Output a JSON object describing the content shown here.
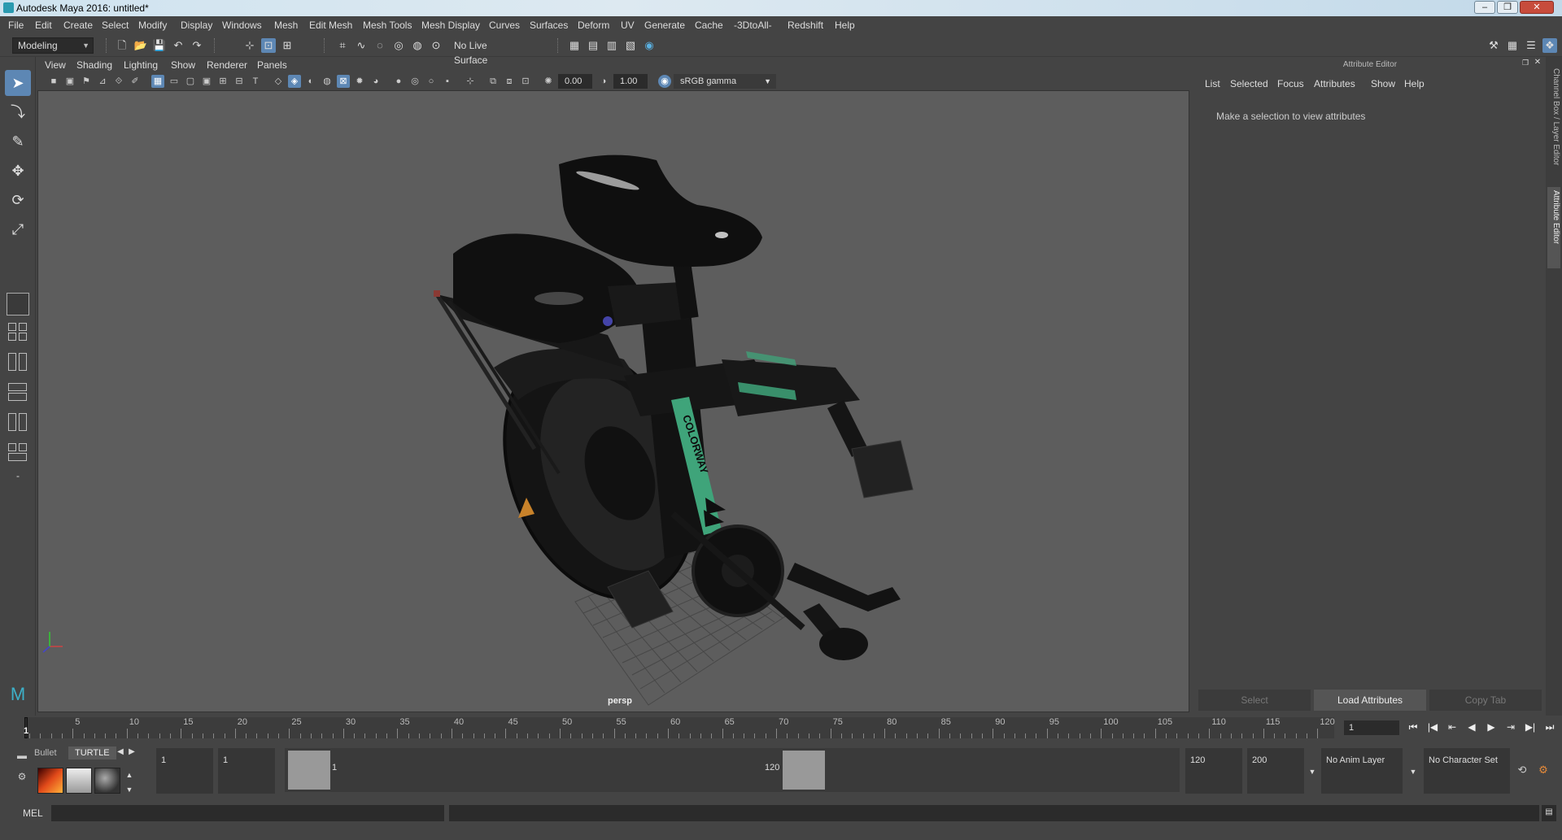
{
  "window": {
    "title": "Autodesk Maya 2016: untitled*",
    "buttons": [
      "–",
      "❐",
      "✕"
    ]
  },
  "menubar": [
    "File",
    "Edit",
    "Create",
    "Select",
    "Modify",
    "Display",
    "Windows",
    "Mesh",
    "Edit Mesh",
    "Mesh Tools",
    "Mesh Display",
    "Curves",
    "Surfaces",
    "Deform",
    "UV",
    "Generate",
    "Cache",
    "-3DtoAll-",
    "Redshift",
    "Help"
  ],
  "toolbar": {
    "mode": "Modeling",
    "live_surface": "No Live Surface"
  },
  "viewport": {
    "menu": [
      "View",
      "Shading",
      "Lighting",
      "Show",
      "Renderer",
      "Panels"
    ],
    "exposure": "0.00",
    "gamma": "1.00",
    "colorspace": "sRGB gamma",
    "camera": "persp",
    "brand_text": "COLORWAY"
  },
  "attribute_editor": {
    "title": "Attribute Editor",
    "menu": [
      "List",
      "Selected",
      "Focus",
      "Attributes",
      "Show",
      "Help"
    ],
    "message": "Make a selection to view attributes",
    "buttons": [
      "Select",
      "Load Attributes",
      "Copy Tab"
    ]
  },
  "side_tabs": [
    "Channel Box / Layer Editor",
    "Attribute Editor"
  ],
  "timeline": {
    "current_frame": "1",
    "ticks": [
      "5",
      "10",
      "15",
      "20",
      "25",
      "30",
      "35",
      "40",
      "45",
      "50",
      "55",
      "60",
      "65",
      "70",
      "75",
      "80",
      "85",
      "90",
      "95",
      "100",
      "105",
      "110",
      "115",
      "120"
    ],
    "frame_field": "1"
  },
  "range": {
    "start_field": "1",
    "playback_start": "1",
    "range_start": "1",
    "range_end": "120",
    "playback_end": "120",
    "end_field": "200",
    "anim_layer": "No Anim Layer",
    "character_set": "No Character Set"
  },
  "shelf_tabs": [
    "Bullet",
    "TURTLE"
  ],
  "commandline": {
    "label": "MEL"
  },
  "colors": {
    "accent": "#5d87b4",
    "stripe": "#3fa47a",
    "background": "#444444",
    "viewport": "#5d5d5d"
  }
}
